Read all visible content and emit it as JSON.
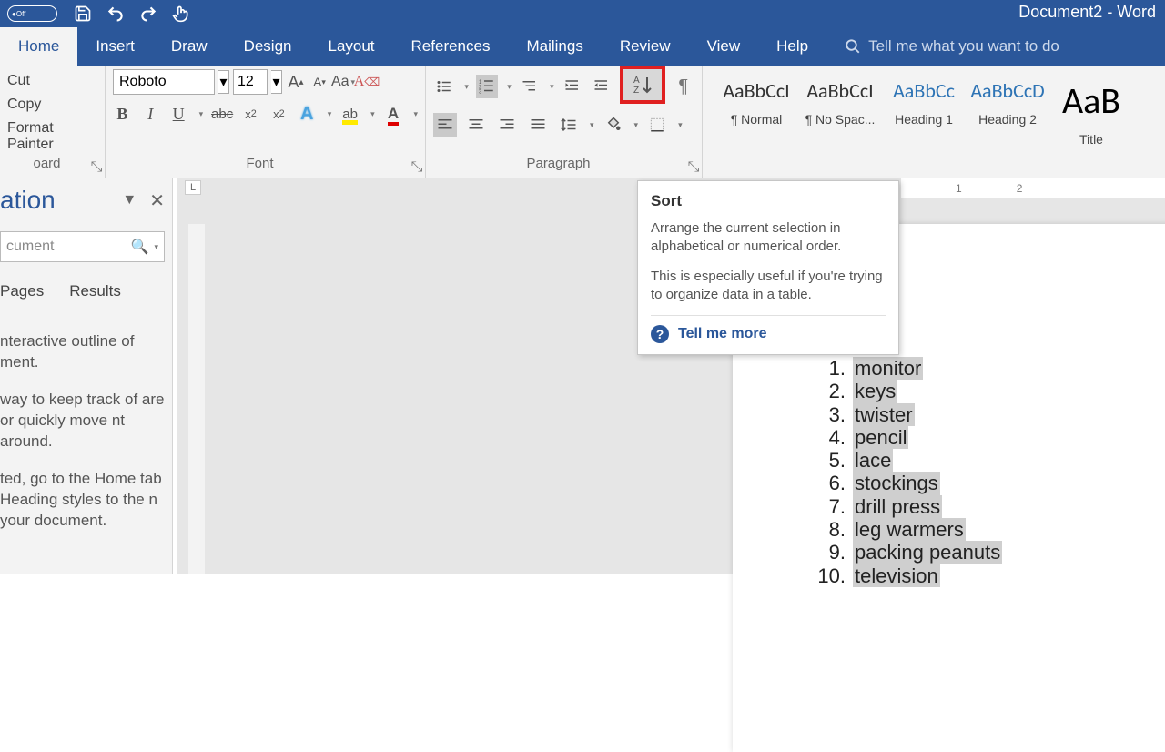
{
  "title": "Document2 - Word",
  "autosave_label": "Off",
  "tabs": [
    "Home",
    "Insert",
    "Draw",
    "Design",
    "Layout",
    "References",
    "Mailings",
    "Review",
    "View",
    "Help"
  ],
  "active_tab_index": 0,
  "tellme_placeholder": "Tell me what you want to do",
  "clipboard": {
    "cut": "Cut",
    "copy": "Copy",
    "painter": "Format Painter",
    "group": "oard"
  },
  "font": {
    "name": "Roboto",
    "size": "12",
    "group": "Font"
  },
  "paragraph": {
    "group": "Paragraph"
  },
  "styles": {
    "items": [
      {
        "preview": "AaBbCcI",
        "name": "¶ Normal",
        "color": "#333"
      },
      {
        "preview": "AaBbCcI",
        "name": "¶ No Spac...",
        "color": "#333"
      },
      {
        "preview": "AaBbCc",
        "name": "Heading 1",
        "color": "#2e74b5"
      },
      {
        "preview": "AaBbCcD",
        "name": "Heading 2",
        "color": "#2e74b5"
      },
      {
        "preview": "AaB",
        "name": "Title",
        "color": "#000",
        "big": true
      }
    ]
  },
  "nav": {
    "title": "ation",
    "search_placeholder": "cument",
    "tabs": [
      "Pages",
      "Results"
    ],
    "help": [
      "nteractive outline of ment.",
      "way to keep track of are or quickly move nt around.",
      "ted, go to the Home tab Heading styles to the n your document."
    ]
  },
  "tooltip": {
    "title": "Sort",
    "p1": "Arrange the current selection in alphabetical or numerical order.",
    "p2": "This is especially useful if you're trying to organize data in a table.",
    "more": "Tell me more"
  },
  "ruler_marks": [
    "1",
    "2"
  ],
  "list_items": [
    "monitor",
    "keys",
    "twister",
    "pencil",
    "lace",
    "stockings",
    "drill press",
    "leg warmers",
    "packing peanuts",
    "television"
  ],
  "colors": {
    "brand": "#2b579a",
    "highlight": "#e02020"
  }
}
